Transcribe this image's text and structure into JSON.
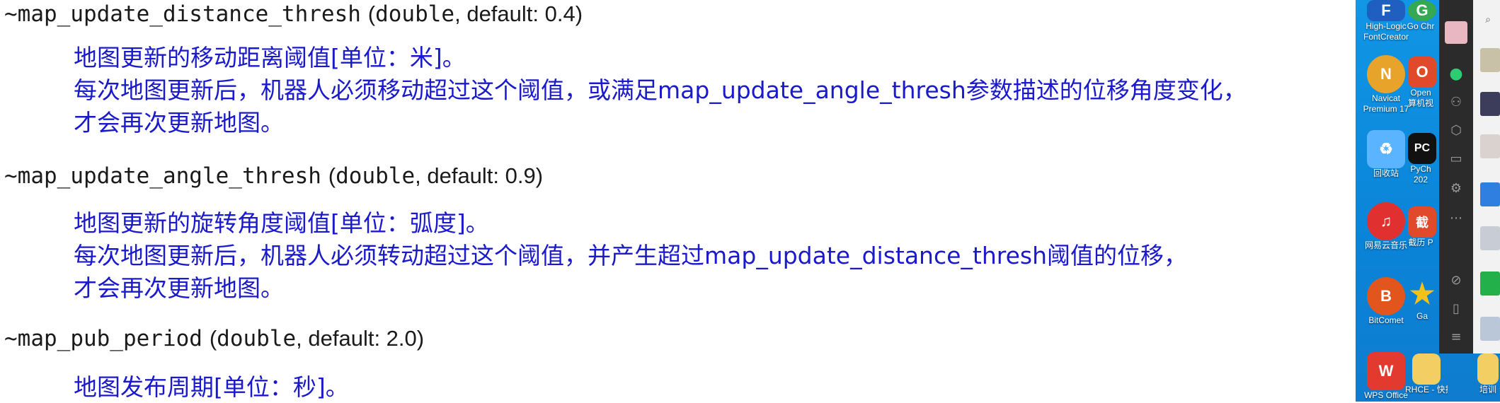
{
  "params": [
    {
      "name": "~map_update_distance_thresh",
      "type": "double",
      "default_label": "default: 0.4",
      "lines": [
        "地图更新的移动距离阈值[单位：米]。",
        "每次地图更新后，机器人必须移动超过这个阈值，或满足map_update_angle_thresh参数描述的位移角度变化，",
        "才会再次更新地图。"
      ]
    },
    {
      "name": "~map_update_angle_thresh",
      "type": "double",
      "default_label": "default: 0.9",
      "lines": [
        "地图更新的旋转角度阈值[单位：弧度]。",
        "每次地图更新后，机器人必须转动超过这个阈值，并产生超过map_update_distance_thresh阈值的位移，",
        "才会再次更新地图。"
      ]
    },
    {
      "name": "~map_pub_period",
      "type": "double",
      "default_label": "default: 2.0",
      "lines": [
        "地图发布周期[单位：秒]。"
      ]
    }
  ],
  "desktop_icons": [
    {
      "label": "High-Logic FontCreator",
      "icon": "fontcreator-icon",
      "color": "#1f5fbf",
      "glyph": "F"
    },
    {
      "label": "Navicat Premium 17",
      "icon": "navicat-icon",
      "color": "#e8a42a",
      "glyph": "N"
    },
    {
      "label": "回收站",
      "icon": "recycle-bin-icon",
      "color": "#5bb4ff",
      "glyph": "♻"
    },
    {
      "label": "网易云音乐",
      "icon": "netease-music-icon",
      "color": "#e03030",
      "glyph": "♫"
    },
    {
      "label": "BitComet",
      "icon": "bitcomet-icon",
      "color": "#e2561e",
      "glyph": "B"
    },
    {
      "label": "WPS Office",
      "icon": "wps-icon",
      "color": "#e23a2e",
      "glyph": "W"
    }
  ],
  "desktop_icons_col2": [
    {
      "label": "Go Chr",
      "icon": "chrome-icon",
      "color": "#34a853",
      "glyph": "G"
    },
    {
      "label": "Open 算机视",
      "icon": "opencv-icon",
      "color": "#e04a2a",
      "glyph": "O"
    },
    {
      "label": "PyCh 202",
      "icon": "pycharm-icon",
      "color": "#111111",
      "glyph": "PC"
    },
    {
      "label": "截历 P",
      "icon": "app-icon",
      "color": "#e04a2a",
      "glyph": "截"
    },
    {
      "label": "Ga",
      "icon": "star-icon",
      "color": "#f2c21b",
      "glyph": "★"
    },
    {
      "label": "RHCE - 快捷",
      "icon": "folder-icon",
      "color": "#f3cf63",
      "glyph": ""
    },
    {
      "label": "培训",
      "icon": "folder-icon",
      "color": "#f3cf63",
      "glyph": ""
    }
  ],
  "side_panel_icons": [
    "search-icon",
    "chat-icon",
    "contacts-icon",
    "cube-icon",
    "folder-icon",
    "settings-icon",
    "more-icon",
    "link-icon",
    "phone-icon",
    "menu-icon"
  ]
}
